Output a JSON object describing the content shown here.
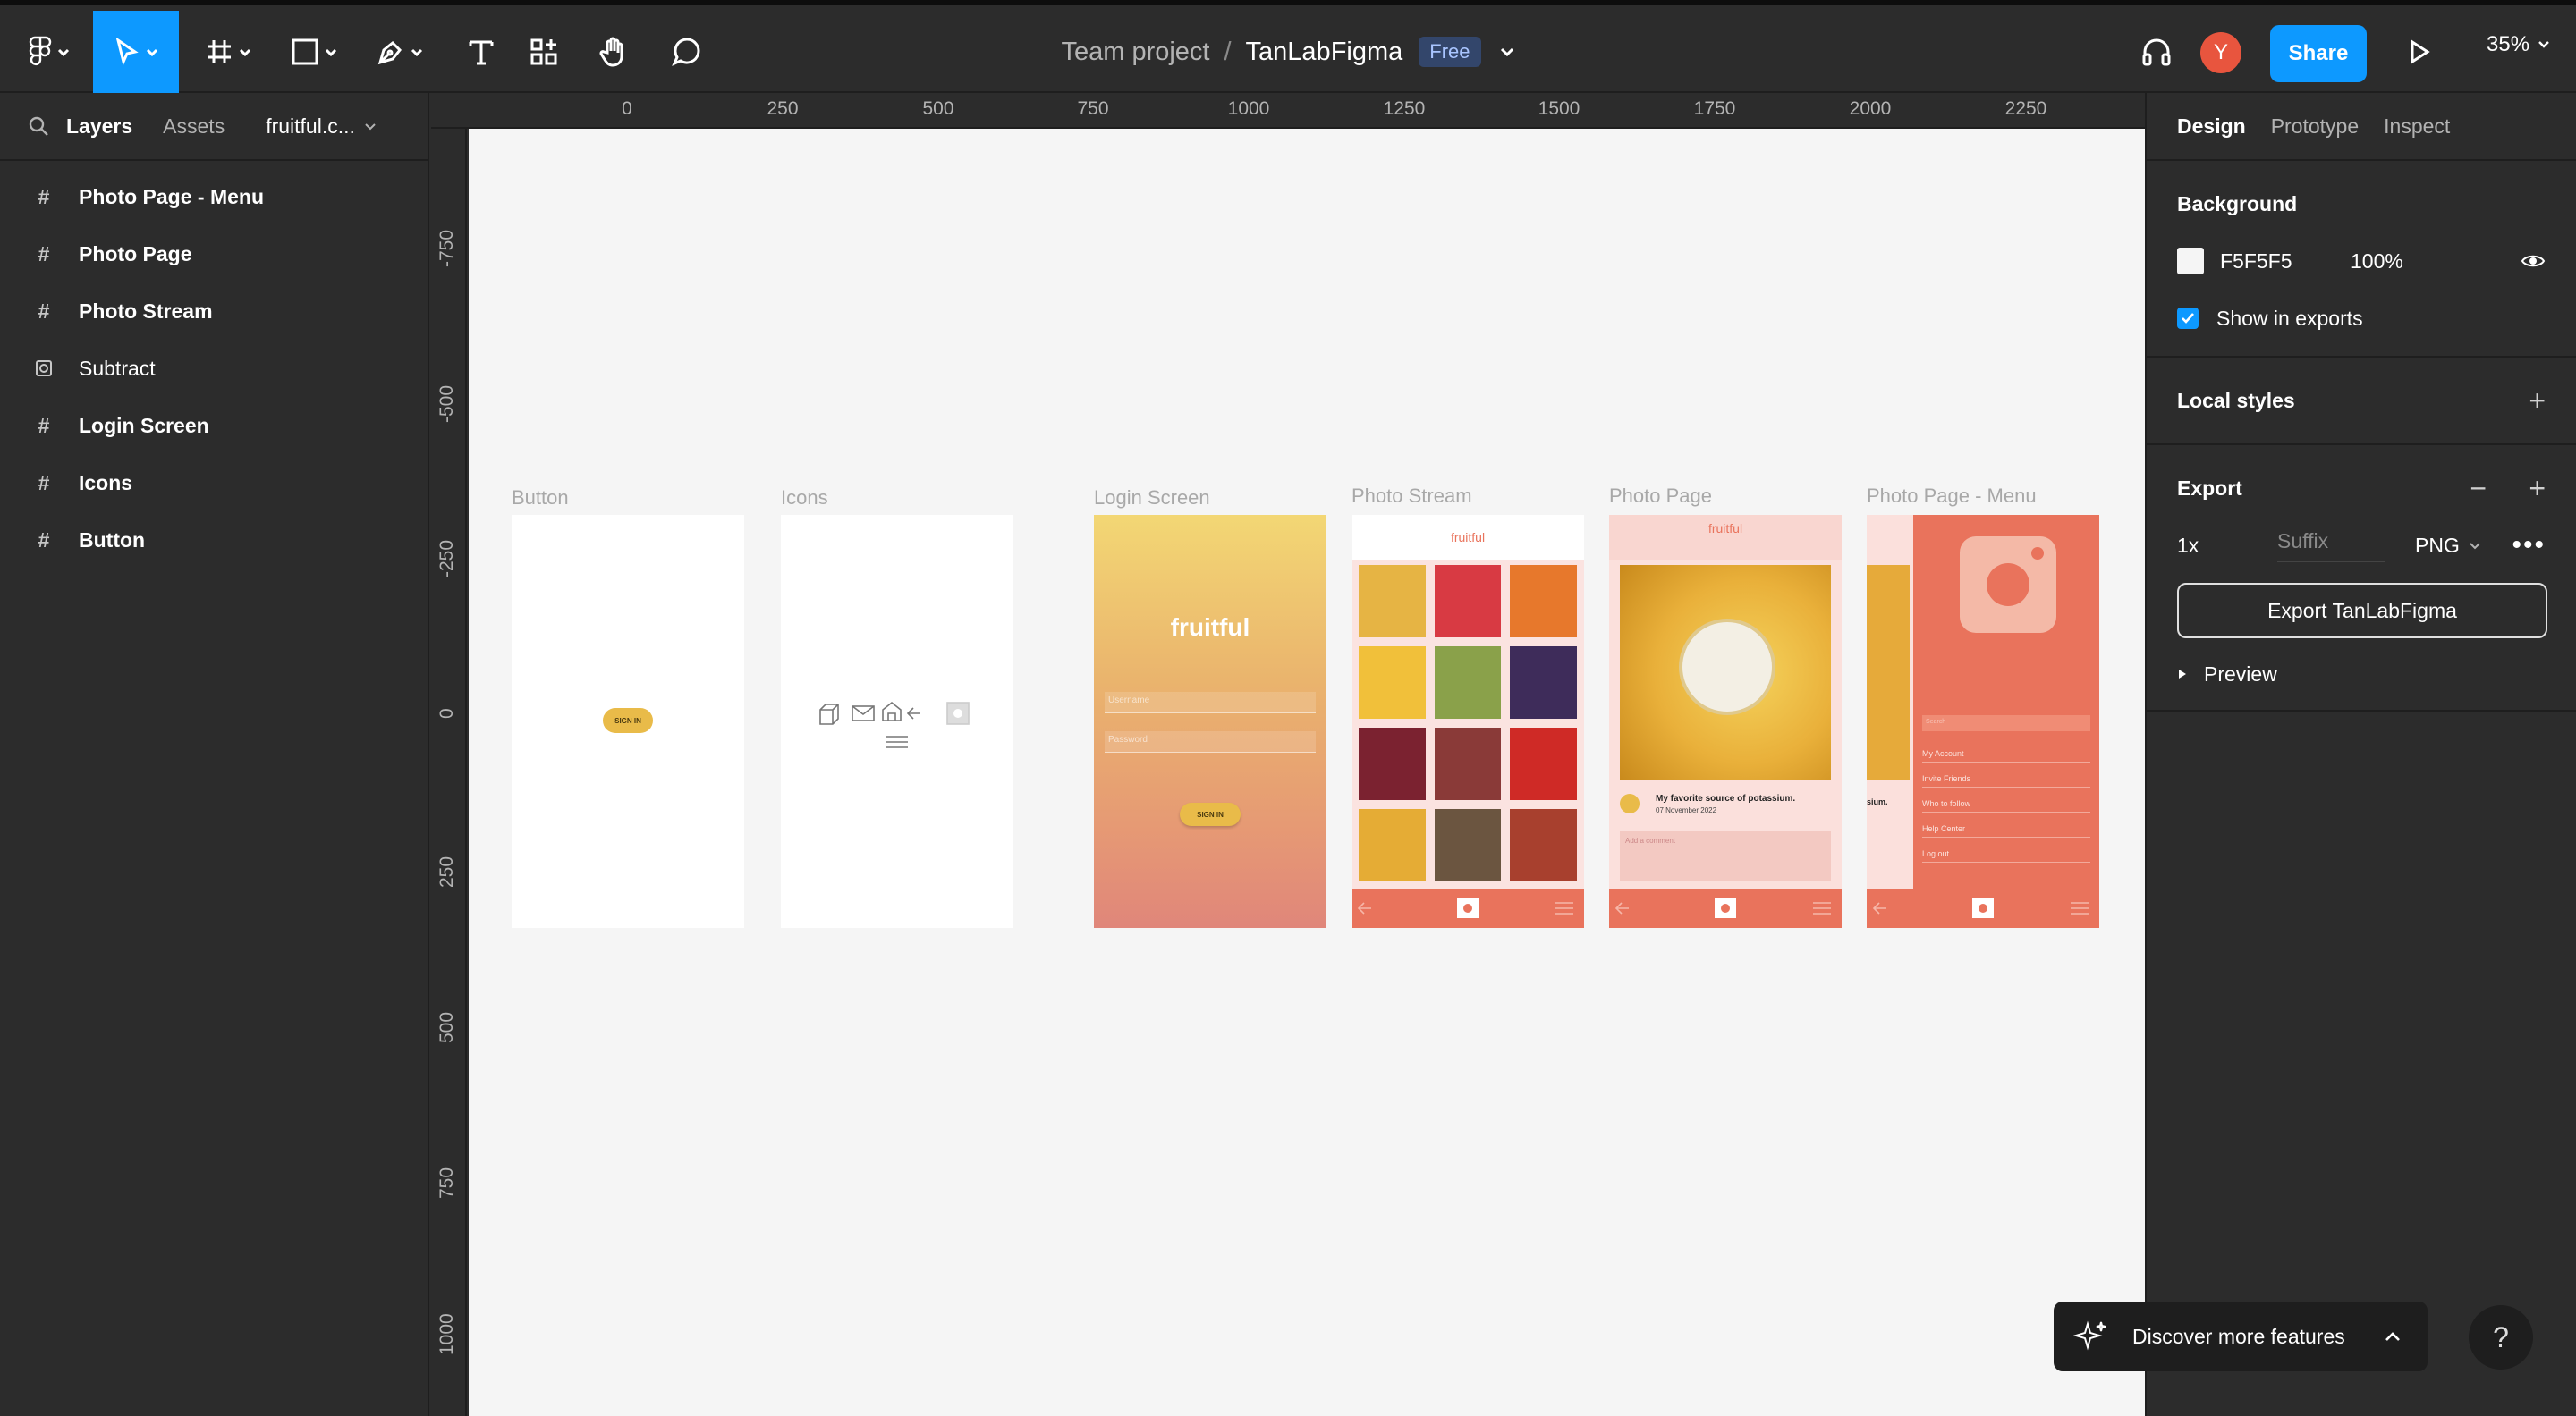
{
  "toolbar": {
    "crumb_team": "Team project",
    "crumb_sep": "/",
    "file_name": "TanLabFigma",
    "plan_badge": "Free",
    "avatar_initial": "Y",
    "share_label": "Share",
    "zoom": "35%"
  },
  "left_panel": {
    "tabs": {
      "layers": "Layers",
      "assets": "Assets"
    },
    "page": "fruitful.c...",
    "layers": [
      {
        "label": "Photo Page - Menu",
        "icon": "frame-icon"
      },
      {
        "label": "Photo Page",
        "icon": "frame-icon"
      },
      {
        "label": "Photo Stream",
        "icon": "frame-icon"
      },
      {
        "label": "Subtract",
        "icon": "boolean-icon"
      },
      {
        "label": "Login Screen",
        "icon": "frame-icon"
      },
      {
        "label": "Icons",
        "icon": "frame-icon"
      },
      {
        "label": "Button",
        "icon": "frame-icon"
      }
    ]
  },
  "rulers": {
    "top": [
      "0",
      "250",
      "500",
      "750",
      "1000",
      "1250",
      "1500",
      "1750",
      "2000",
      "2250"
    ],
    "left": [
      "-750",
      "-500",
      "-250",
      "0",
      "250",
      "500",
      "750",
      "1000"
    ]
  },
  "canvas": {
    "frames": {
      "button": {
        "label": "Button",
        "sign_in": "SIGN IN"
      },
      "icons": {
        "label": "Icons"
      },
      "login": {
        "label": "Login Screen",
        "logo": "fruitful",
        "username": "Username",
        "password": "Password",
        "sign_in": "SIGN IN"
      },
      "stream": {
        "label": "Photo Stream",
        "logo": "fruitful"
      },
      "photo": {
        "label": "Photo Page",
        "logo": "fruitful",
        "caption": "My favorite source of potassium.",
        "date": "07 November 2022",
        "comment_placeholder": "Add a comment"
      },
      "menu": {
        "label": "Photo Page - Menu",
        "search": "Search",
        "items": [
          "My Account",
          "Invite Friends",
          "Who to follow",
          "Help Center",
          "Log out"
        ],
        "cut_text": "sium."
      }
    }
  },
  "right_panel": {
    "tabs": {
      "design": "Design",
      "prototype": "Prototype",
      "inspect": "Inspect"
    },
    "background": {
      "title": "Background",
      "hex": "F5F5F5",
      "opacity": "100%",
      "show_in_exports": "Show in exports"
    },
    "local_styles": "Local styles",
    "export": {
      "title": "Export",
      "scale": "1x",
      "suffix_placeholder": "Suffix",
      "format": "PNG",
      "button": "Export TanLabFigma",
      "preview": "Preview"
    }
  },
  "footer": {
    "discover": "Discover more features",
    "help": "?"
  },
  "colors": {
    "accent": "#0d99ff",
    "panel": "#2c2c2c",
    "canvas": "#f5f5f5",
    "coral": "#e9735c",
    "gold": "#e9bb49"
  }
}
